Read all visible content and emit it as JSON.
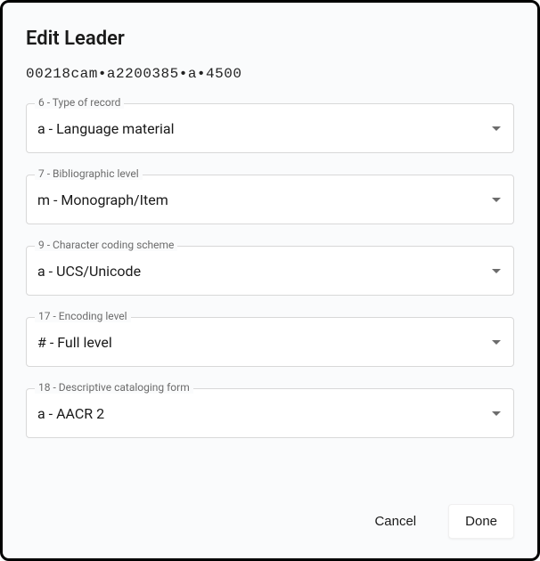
{
  "dialog": {
    "title": "Edit Leader",
    "leader_string": "00218cam•a2200385•a•4500"
  },
  "fields": [
    {
      "label": "6 - Type of record",
      "value": "a - Language material"
    },
    {
      "label": "7 - Bibliographic level",
      "value": "m - Monograph/Item"
    },
    {
      "label": "9 - Character coding scheme",
      "value": "a - UCS/Unicode"
    },
    {
      "label": "17 - Encoding level",
      "value": "# - Full level"
    },
    {
      "label": "18 - Descriptive cataloging form",
      "value": "a - AACR 2"
    }
  ],
  "footer": {
    "cancel": "Cancel",
    "done": "Done"
  }
}
